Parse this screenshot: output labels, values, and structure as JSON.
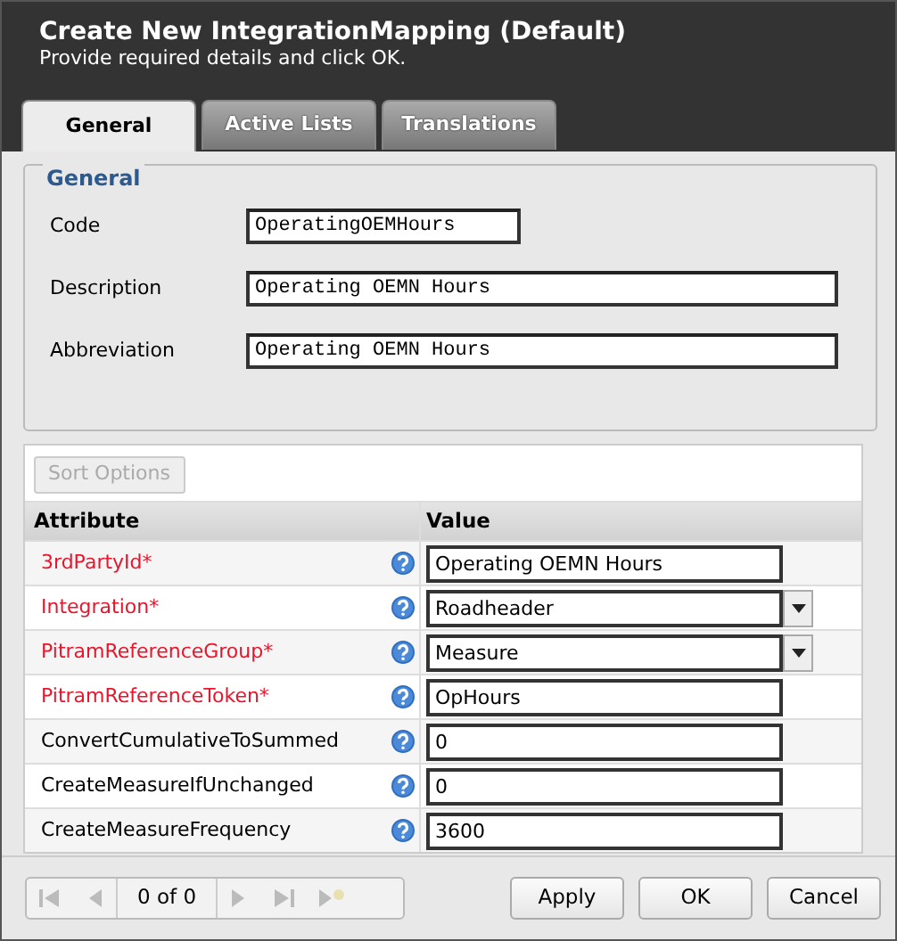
{
  "dialog": {
    "title": "Create New IntegrationMapping (Default)",
    "subtitle": "Provide required details and click OK."
  },
  "tabs": [
    {
      "label": "General",
      "selected": true
    },
    {
      "label": "Active Lists",
      "selected": false
    },
    {
      "label": "Translations",
      "selected": false
    }
  ],
  "general": {
    "legend": "General",
    "fields": [
      {
        "label": "Code",
        "value": "OperatingOEMHours",
        "wide": false
      },
      {
        "label": "Description",
        "value": "Operating OEMN Hours",
        "wide": true
      },
      {
        "label": "Abbreviation",
        "value": "Operating OEMN Hours",
        "wide": true
      }
    ]
  },
  "grid": {
    "sort_button": {
      "label": "Sort Options",
      "disabled": true
    },
    "columns": [
      "Attribute",
      "Value"
    ],
    "rows": [
      {
        "attribute": "3rdPartyId*",
        "required": true,
        "kind": "text",
        "value": "Operating OEMN Hours"
      },
      {
        "attribute": "Integration*",
        "required": true,
        "kind": "select",
        "value": "Roadheader"
      },
      {
        "attribute": "PitramReferenceGroup*",
        "required": true,
        "kind": "select",
        "value": "Measure"
      },
      {
        "attribute": "PitramReferenceToken*",
        "required": true,
        "kind": "text",
        "value": "OpHours"
      },
      {
        "attribute": "ConvertCumulativeToSummed",
        "required": false,
        "kind": "text",
        "value": "0"
      },
      {
        "attribute": "CreateMeasureIfUnchanged",
        "required": false,
        "kind": "text",
        "value": "0"
      },
      {
        "attribute": "CreateMeasureFrequency",
        "required": false,
        "kind": "text",
        "value": "3600"
      }
    ]
  },
  "pager": {
    "text": "0 of 0",
    "disabled": true
  },
  "buttons": [
    "Apply",
    "OK",
    "Cancel"
  ]
}
